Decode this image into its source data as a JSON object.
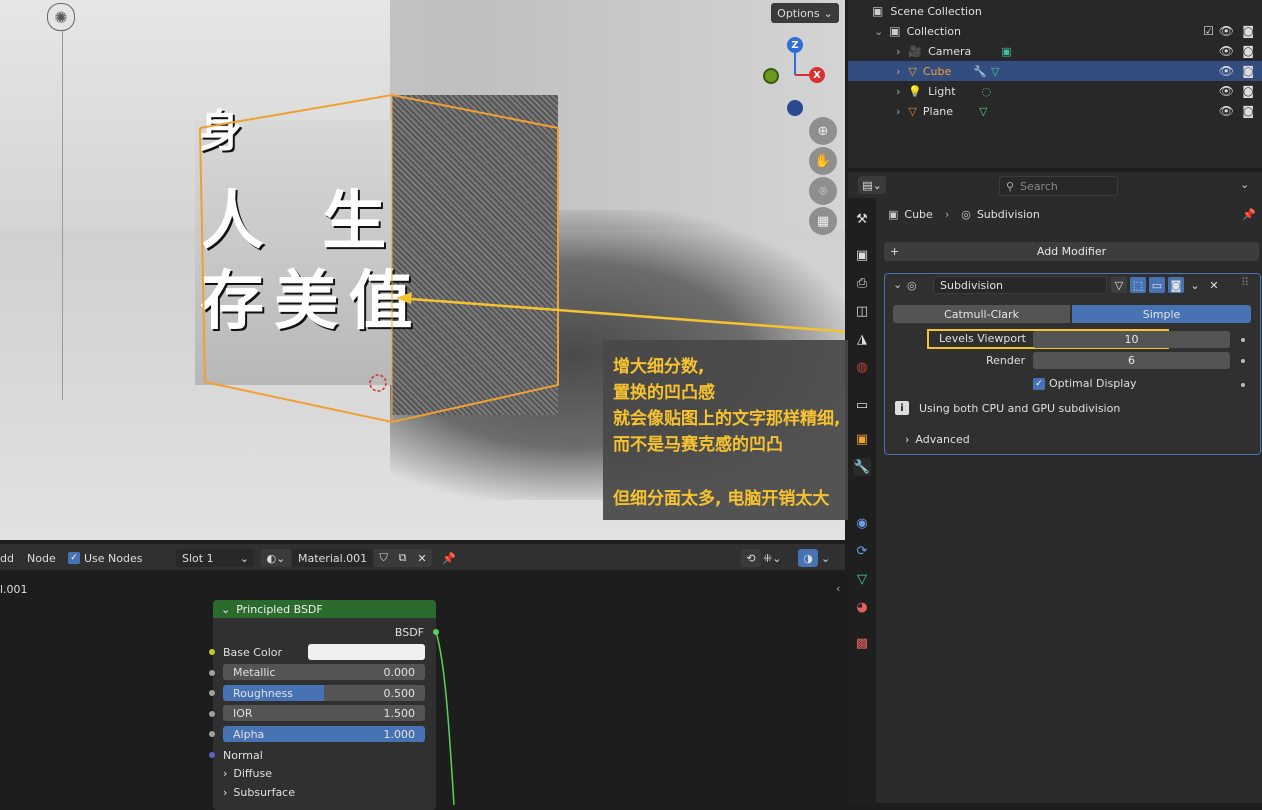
{
  "viewport": {
    "options_label": "Options",
    "cube_text_lines": [
      "身",
      "人 生",
      "存 美 值"
    ],
    "gizmo": {
      "z": "Z",
      "x": "X"
    }
  },
  "callout": {
    "lines": [
      "增大细分数,",
      "置换的凹凸感",
      "就会像贴图上的文字那样精细,",
      "而不是马赛克感的凹凸",
      "但细分面太多, 电脑开销太大"
    ],
    "color": "#f6c230"
  },
  "outliner": {
    "root": "Scene Collection",
    "collection": "Collection",
    "items": [
      {
        "label": "Camera",
        "icon": "camera-icon"
      },
      {
        "label": "Cube",
        "icon": "mesh-icon",
        "selected": true
      },
      {
        "label": "Light",
        "icon": "light-icon"
      },
      {
        "label": "Plane",
        "icon": "mesh-icon"
      }
    ]
  },
  "properties": {
    "search_placeholder": "Search",
    "breadcrumb": {
      "object": "Cube",
      "modifier": "Subdivision"
    },
    "add_modifier": "Add Modifier",
    "modifier": {
      "name": "Subdivision",
      "modes": [
        "Catmull-Clark",
        "Simple"
      ],
      "active_mode": "Simple",
      "levels_viewport_label": "Levels Viewport",
      "levels_viewport": "10",
      "render_label": "Render",
      "render": "6",
      "optimal_display": "Optimal Display",
      "info": "Using both CPU and GPU subdivision",
      "advanced": "Advanced"
    }
  },
  "node_header": {
    "add": "dd",
    "node": "Node",
    "use_nodes": "Use Nodes",
    "slot": "Slot 1",
    "material": "Material.001",
    "tree_label": "l.001"
  },
  "node": {
    "title": "Principled BSDF",
    "output": "BSDF",
    "base_color": "Base Color",
    "metallic": {
      "label": "Metallic",
      "value": "0.000",
      "fraction": 0
    },
    "roughness": {
      "label": "Roughness",
      "value": "0.500",
      "fraction": 0.5
    },
    "ior": {
      "label": "IOR",
      "value": "1.500"
    },
    "alpha": {
      "label": "Alpha",
      "value": "1.000",
      "fraction": 1
    },
    "normal": "Normal",
    "diffuse": "Diffuse",
    "subsurface": "Subsurface"
  },
  "colors": {
    "accent": "#4772b3",
    "selected_object": "#f0a030",
    "highlight_box": "#f6c230"
  }
}
